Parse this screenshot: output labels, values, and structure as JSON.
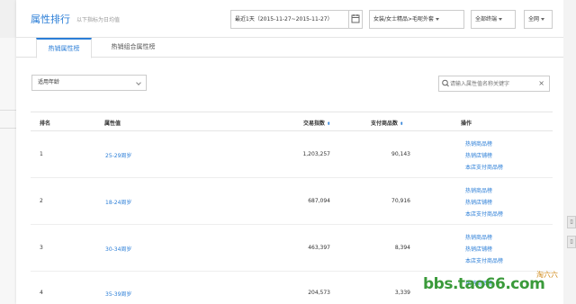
{
  "header": {
    "title": "属性排行",
    "subtitle": "以下指标为日均值",
    "date_range": "最近1天（2015-11-27~2015-11-27）",
    "category": "女装/女士精品>毛呢外套",
    "terminal": "全部终端",
    "scope": "全网"
  },
  "tabs": [
    {
      "label": "热销属性榜"
    },
    {
      "label": "热销组合属性榜"
    }
  ],
  "filter": {
    "select_value": "适用年龄"
  },
  "search": {
    "placeholder": "请输入属性值名称关键字"
  },
  "table": {
    "columns": {
      "rank": "排名",
      "attr": "属性值",
      "trade": "交易指数",
      "pay": "支付商品数",
      "action": "操作"
    },
    "rows": [
      {
        "rank": "1",
        "attr": "25-29周岁",
        "trade": "1,203,257",
        "pay": "90,143",
        "actions": [
          "热销商品榜",
          "热销店铺榜",
          "本店支付商品榜"
        ]
      },
      {
        "rank": "2",
        "attr": "18-24周岁",
        "trade": "687,094",
        "pay": "70,916",
        "actions": [
          "热销商品榜",
          "热销店铺榜",
          "本店支付商品榜"
        ]
      },
      {
        "rank": "3",
        "attr": "30-34周岁",
        "trade": "463,397",
        "pay": "8,394",
        "actions": [
          "热销商品榜",
          "热销店铺榜",
          "本店支付商品榜"
        ]
      },
      {
        "rank": "4",
        "attr": "35-39周岁",
        "trade": "204,573",
        "pay": "3,339",
        "actions": [
          "热销商品榜"
        ]
      }
    ]
  },
  "watermark": {
    "text": "bbs.tao66.com",
    "brand": "淘六六"
  }
}
